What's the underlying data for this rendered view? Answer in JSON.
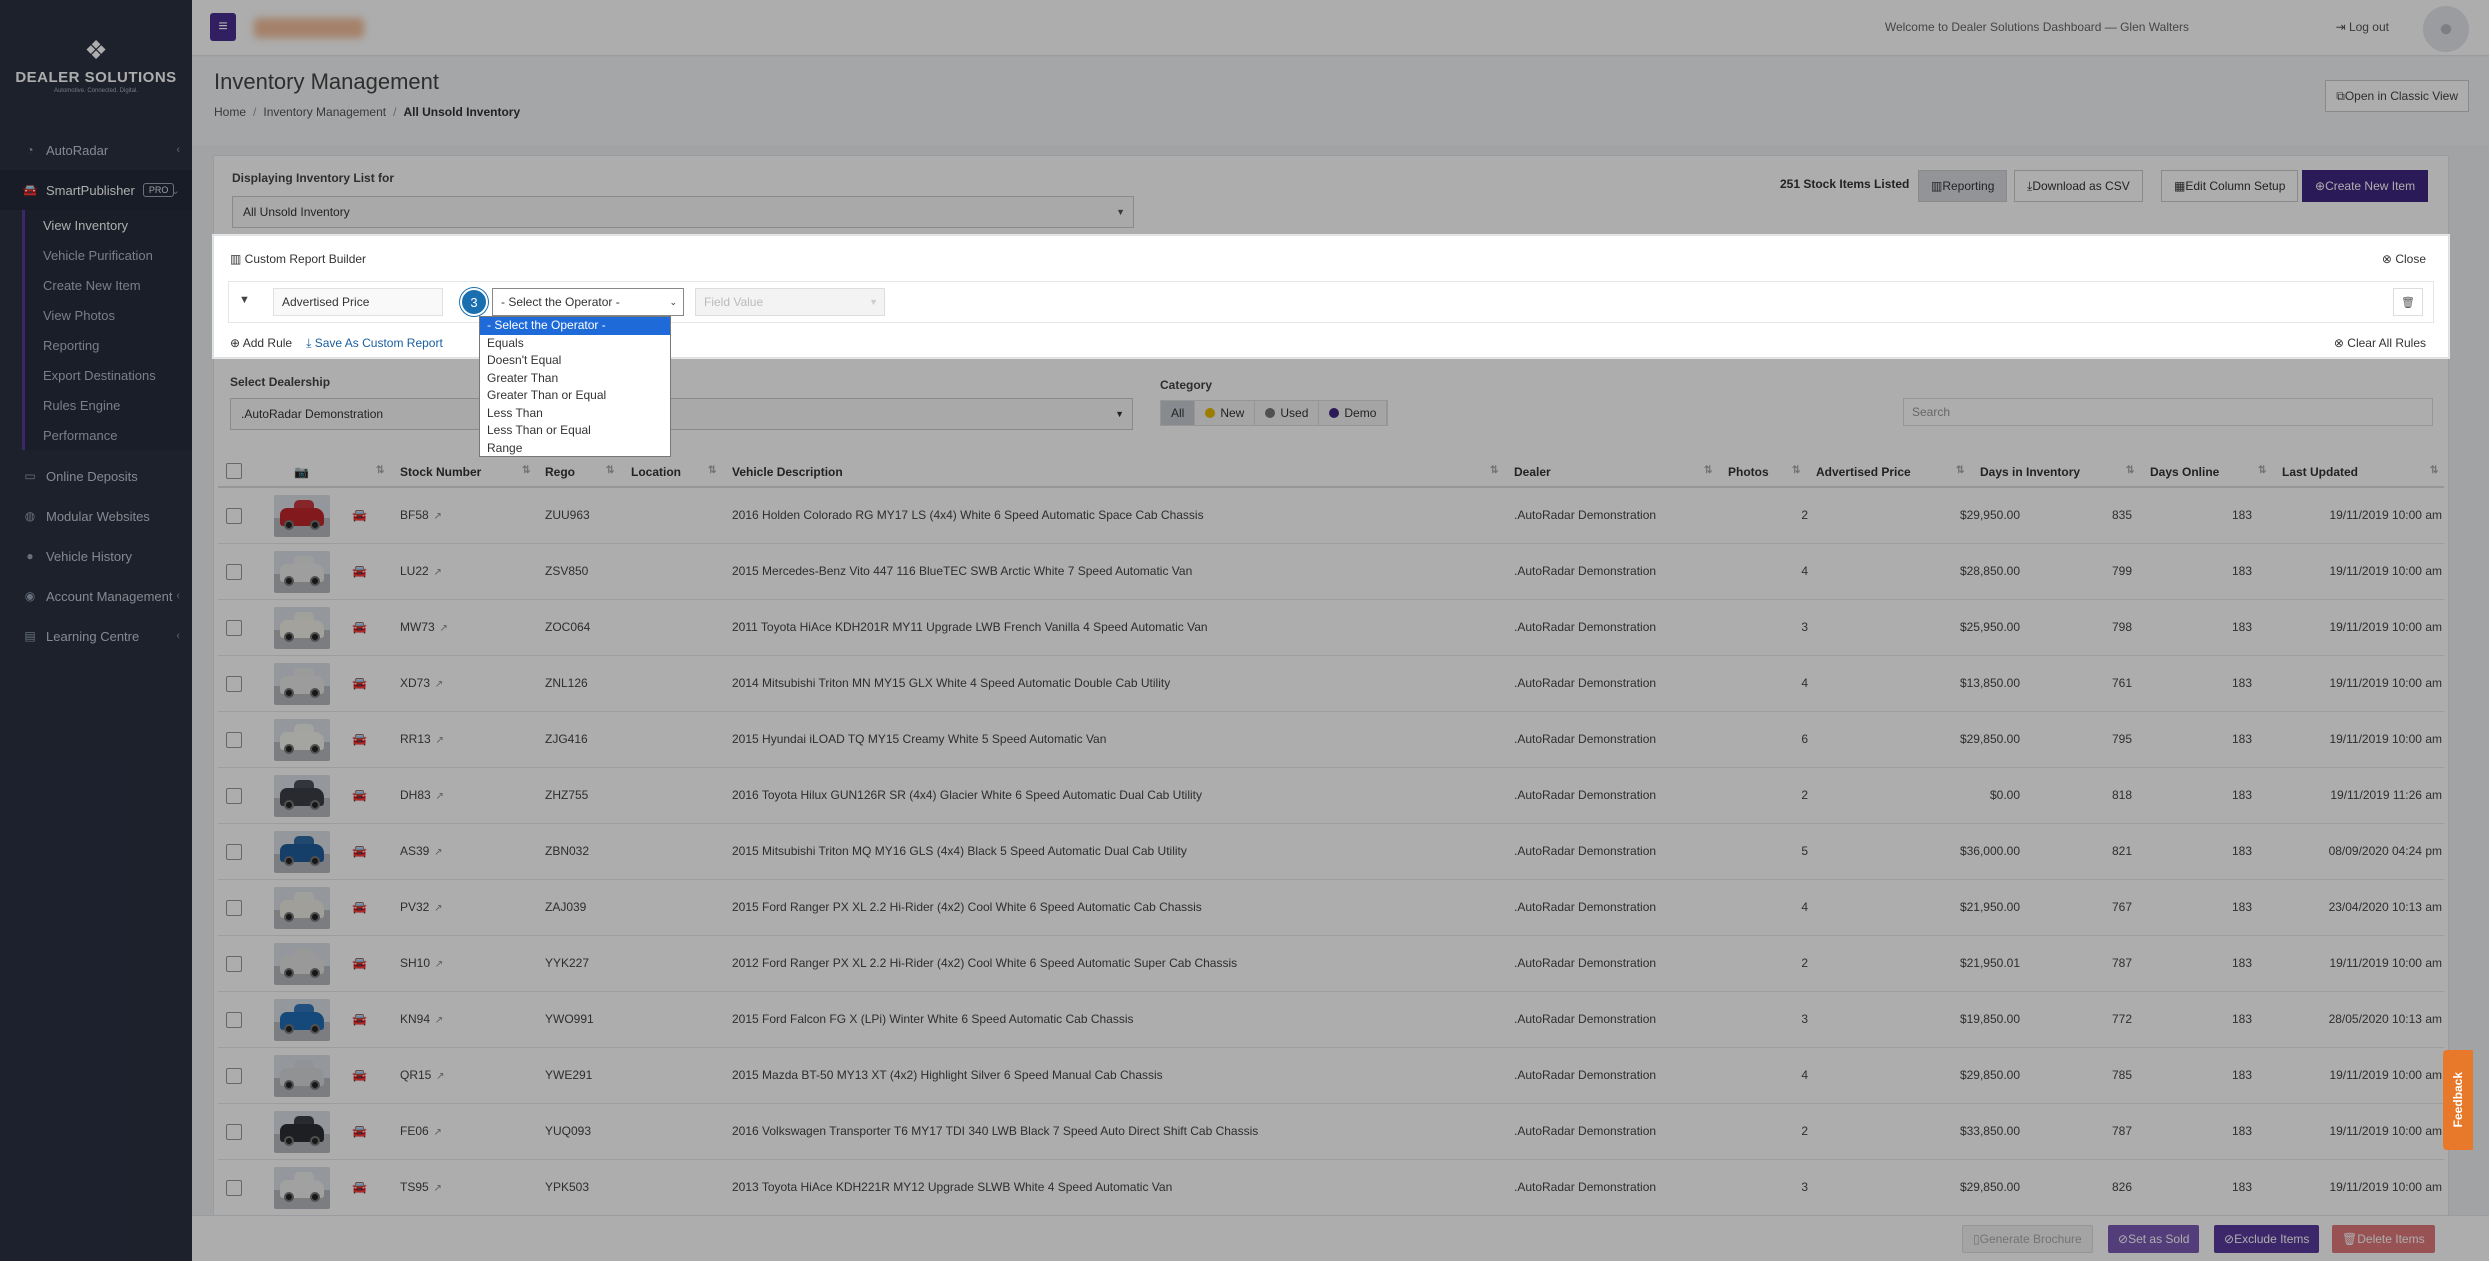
{
  "app": {
    "brand": "DEALER SOLUTIONS",
    "brand_sub": "Automotive. Connected. Digital.",
    "welcome": "Welcome to Dealer Solutions Dashboard — Glen Walters",
    "logout": "Log out"
  },
  "sidebar": {
    "autoradar": "AutoRadar",
    "smartpublisher": "SmartPublisher",
    "pro": "PRO",
    "sub": [
      "View Inventory",
      "Vehicle Purification",
      "Create New Item",
      "View Photos",
      "Reporting",
      "Export Destinations",
      "Rules Engine",
      "Performance"
    ],
    "online_deposits": "Online Deposits",
    "modular_websites": "Modular Websites",
    "vehicle_history": "Vehicle History",
    "account_management": "Account Management",
    "learning_centre": "Learning Centre"
  },
  "page": {
    "title": "Inventory Management",
    "crumbs": [
      "Home",
      "Inventory Management",
      "All Unsold Inventory"
    ],
    "classic": "Open in Classic View"
  },
  "panel": {
    "display_label": "Displaying Inventory List for",
    "display_value": "All Unsold Inventory",
    "count": "251 Stock Items Listed",
    "reporting": "Reporting",
    "csv": "Download as CSV",
    "columns": "Edit Column Setup",
    "create": "Create New Item"
  },
  "crb": {
    "title": "Custom Report Builder",
    "close": "Close",
    "field": "Advertised Price",
    "step": "3",
    "operator": "- Select the Operator -",
    "field_value": "Field Value",
    "add_rule": "Add Rule",
    "save": "Save As Custom Report",
    "clear": "Clear All Rules",
    "options": [
      "- Select the Operator -",
      "Equals",
      "Doesn't Equal",
      "Greater Than",
      "Greater Than or Equal",
      "Less Than",
      "Less Than or Equal",
      "Range"
    ]
  },
  "filters": {
    "dealership_label": "Select Dealership",
    "dealership_value": ".AutoRadar Demonstration",
    "category_label": "Category",
    "cat": [
      "All",
      "New",
      "Used",
      "Demo"
    ],
    "search_placeholder": "Search"
  },
  "table": {
    "headers": [
      "Stock Number",
      "Rego",
      "Location",
      "Vehicle Description",
      "Dealer",
      "Photos",
      "Advertised Price",
      "Days in Inventory",
      "Days Online",
      "Last Updated"
    ],
    "rows": [
      {
        "stock": "BF58",
        "rego": "ZUU963",
        "desc": "2016 Holden Colorado RG MY17 LS (4x4) White 6 Speed Automatic Space Cab Chassis",
        "dealer": ".AutoRadar Demonstration",
        "photos": "2",
        "price": "$29,950.00",
        "dii": "835",
        "do": "183",
        "updated": "19/11/2019 10:00 am",
        "color": "#c0262c"
      },
      {
        "stock": "LU22",
        "rego": "ZSV850",
        "desc": "2015 Mercedes-Benz Vito 447 116 BlueTEC SWB Arctic White 7 Speed Automatic Van",
        "dealer": ".AutoRadar Demonstration",
        "photos": "4",
        "price": "$28,850.00",
        "dii": "799",
        "do": "183",
        "updated": "19/11/2019 10:00 am",
        "color": "#e9e9e9"
      },
      {
        "stock": "MW73",
        "rego": "ZOC064",
        "desc": "2011 Toyota HiAce KDH201R MY11 Upgrade LWB French Vanilla 4 Speed Automatic Van",
        "dealer": ".AutoRadar Demonstration",
        "photos": "3",
        "price": "$25,950.00",
        "dii": "798",
        "do": "183",
        "updated": "19/11/2019 10:00 am",
        "color": "#f0efe6"
      },
      {
        "stock": "XD73",
        "rego": "ZNL126",
        "desc": "2014 Mitsubishi Triton MN MY15 GLX White 4 Speed Automatic Double Cab Utility",
        "dealer": ".AutoRadar Demonstration",
        "photos": "4",
        "price": "$13,850.00",
        "dii": "761",
        "do": "183",
        "updated": "19/11/2019 10:00 am",
        "color": "#e6e6e6"
      },
      {
        "stock": "RR13",
        "rego": "ZJG416",
        "desc": "2015 Hyundai iLOAD TQ MY15 Creamy White 5 Speed Automatic Van",
        "dealer": ".AutoRadar Demonstration",
        "photos": "6",
        "price": "$29,850.00",
        "dii": "795",
        "do": "183",
        "updated": "19/11/2019 10:00 am",
        "color": "#f2f2ee"
      },
      {
        "stock": "DH83",
        "rego": "ZHZ755",
        "desc": "2016 Toyota Hilux GUN126R SR (4x4) Glacier White 6 Speed Automatic Dual Cab Utility",
        "dealer": ".AutoRadar Demonstration",
        "photos": "2",
        "price": "$0.00",
        "dii": "818",
        "do": "183",
        "updated": "19/11/2019 11:26 am",
        "color": "#3b3f47"
      },
      {
        "stock": "AS39",
        "rego": "ZBN032",
        "desc": "2015 Mitsubishi Triton MQ MY16 GLS (4x4) Black 5 Speed Automatic Dual Cab Utility",
        "dealer": ".AutoRadar Demonstration",
        "photos": "5",
        "price": "$36,000.00",
        "dii": "821",
        "do": "183",
        "updated": "08/09/2020 04:24 pm",
        "color": "#1f5d9a"
      },
      {
        "stock": "PV32",
        "rego": "ZAJ039",
        "desc": "2015 Ford Ranger PX XL 2.2 Hi-Rider (4x2) Cool White 6 Speed Automatic Cab Chassis",
        "dealer": ".AutoRadar Demonstration",
        "photos": "4",
        "price": "$21,950.00",
        "dii": "767",
        "do": "183",
        "updated": "23/04/2020 10:13 am",
        "color": "#ecebe4"
      },
      {
        "stock": "SH10",
        "rego": "YYK227",
        "desc": "2012 Ford Ranger PX XL 2.2 Hi-Rider (4x2) Cool White 6 Speed Automatic Super Cab Chassis",
        "dealer": ".AutoRadar Demonstration",
        "photos": "2",
        "price": "$21,950.01",
        "dii": "787",
        "do": "183",
        "updated": "19/11/2019 10:00 am",
        "color": "#e2e2e2"
      },
      {
        "stock": "KN94",
        "rego": "YWO991",
        "desc": "2015 Ford Falcon FG X (LPi) Winter White 6 Speed Automatic Cab Chassis",
        "dealer": ".AutoRadar Demonstration",
        "photos": "3",
        "price": "$19,850.00",
        "dii": "772",
        "do": "183",
        "updated": "28/05/2020 10:13 am",
        "color": "#1f6bb5"
      },
      {
        "stock": "QR15",
        "rego": "YWE291",
        "desc": "2015 Mazda BT-50 MY13 XT (4x2) Highlight Silver 6 Speed Manual Cab Chassis",
        "dealer": ".AutoRadar Demonstration",
        "photos": "4",
        "price": "$29,850.00",
        "dii": "785",
        "do": "183",
        "updated": "19/11/2019 10:00 am",
        "color": "#d6d8db"
      },
      {
        "stock": "FE06",
        "rego": "YUQ093",
        "desc": "2016 Volkswagen Transporter T6 MY17 TDI 340 LWB Black 7 Speed Auto Direct Shift Cab Chassis",
        "dealer": ".AutoRadar Demonstration",
        "photos": "2",
        "price": "$33,850.00",
        "dii": "787",
        "do": "183",
        "updated": "19/11/2019 10:00 am",
        "color": "#2b2e33"
      },
      {
        "stock": "TS95",
        "rego": "YPK503",
        "desc": "2013 Toyota HiAce KDH221R MY12 Upgrade SLWB White 4 Speed Automatic Van",
        "dealer": ".AutoRadar Demonstration",
        "photos": "3",
        "price": "$29,850.00",
        "dii": "826",
        "do": "183",
        "updated": "19/11/2019 10:00 am",
        "color": "#eeeeee"
      }
    ]
  },
  "bottom": {
    "brochure": "Generate Brochure",
    "sold": "Set as Sold",
    "exclude": "Exclude Items",
    "delete": "Delete Items"
  },
  "feedback": "Feedback",
  "colors": {
    "sidebar": "#2a3142",
    "primary": "#3f2780",
    "accent_blue": "#1e6ad9",
    "new_dot": "#e6b800",
    "used_dot": "#777777",
    "demo_dot": "#3f2780",
    "sold": "#7b5bb5",
    "exclude": "#5b3a9e",
    "delete": "#e0797c"
  }
}
